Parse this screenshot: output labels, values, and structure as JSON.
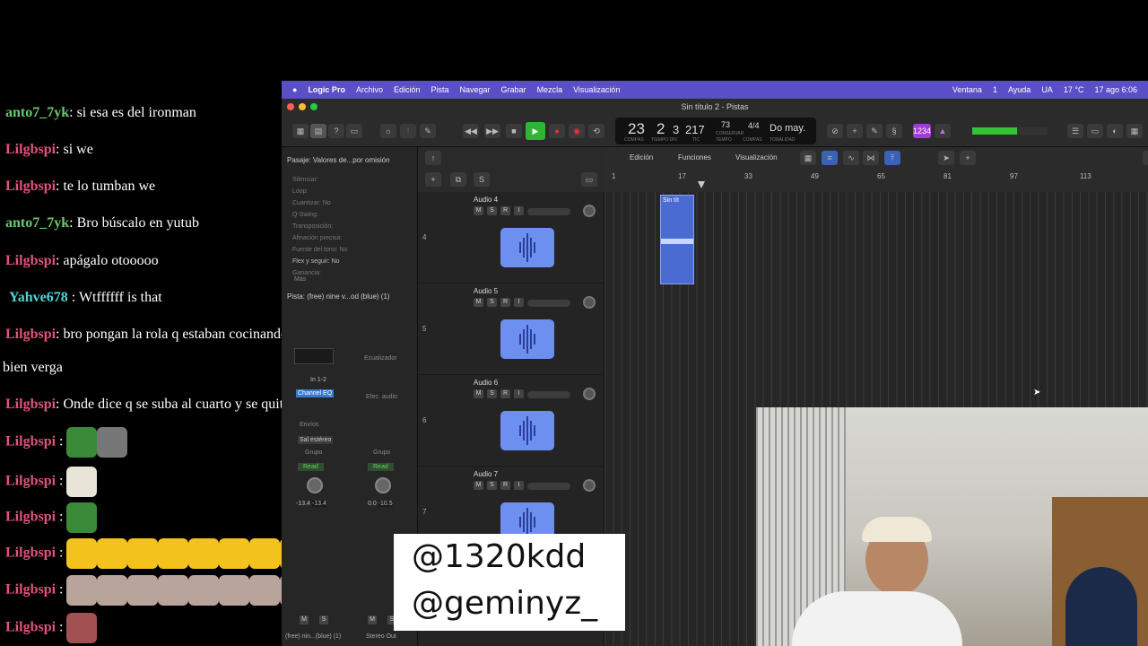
{
  "chat": [
    {
      "user": "anto7_7yk",
      "color": "#6cc86c",
      "text": ": si esa es del ironman"
    },
    {
      "user": "Lilgbspi",
      "color": "#e0547a",
      "text": ": si we"
    },
    {
      "user": "Lilgbspi",
      "color": "#e0547a",
      "text": ": te lo tumban we"
    },
    {
      "user": "anto7_7yk",
      "color": "#6cc86c",
      "text": ": Bro búscalo en yutub"
    },
    {
      "user": "Lilgbspi",
      "color": "#e0547a",
      "text": ": apágalo otooooo"
    },
    {
      "user": "Yahve678",
      "color": "#4fd6d6",
      "text": " : Wtffffff is that"
    },
    {
      "user": "Lilgbspi",
      "color": "#e0547a",
      "text": ": bro pongan la rola q estaban cocinando hace rato está"
    },
    {
      "user": "",
      "color": "#fff",
      "text": "bien verga"
    },
    {
      "user": "Lilgbspi",
      "color": "#e0547a",
      "text": ": Onde dice q se suba al cuarto y se quite los Valentino"
    },
    {
      "user": "Lilgbspi",
      "color": "#e0547a",
      "text": " :"
    },
    {
      "user": "Lilgbspi",
      "color": "#e0547a",
      "text": " :"
    },
    {
      "user": "Lilgbspi",
      "color": "#e0547a",
      "text": " :"
    },
    {
      "user": "Lilgbspi",
      "color": "#e0547a",
      "text": " :"
    },
    {
      "user": "Lilgbspi",
      "color": "#e0547a",
      "text": " :"
    },
    {
      "user": "Lilgbspi",
      "color": "#e0547a",
      "text": " :"
    }
  ],
  "menubar": {
    "app": "Logic Pro",
    "items": [
      "Archivo",
      "Edición",
      "Pista",
      "Navegar",
      "Grabar",
      "Mezcla",
      "Visualización"
    ],
    "right": [
      "Ventana",
      "1",
      "Ayuda",
      "UA",
      "17 °C",
      "17 ago 6:06"
    ]
  },
  "window_title": "Sin título 2 - Pistas",
  "lcd": {
    "bar": "23",
    "beat": "2",
    "div": "3",
    "tick": "217",
    "tempo": "73",
    "sig": "4/4",
    "key": "Do may.",
    "l1": "COMPÁS",
    "l2": "TIEMPO DIV.",
    "l3": "TIC",
    "l4": "TEMPO",
    "l5": "COMPÁS",
    "l6": "TONALIDAD",
    "tempo_mode": "CONSERVAR"
  },
  "toolbar": {
    "count": "1234"
  },
  "inspector": {
    "passage": "Pasaje: Valores de...por omisión",
    "rows": [
      "Silenciar:",
      "Loop:",
      "Cuantizar: No",
      "Q-Swing:",
      "Transposición:",
      "Afinación precisa:",
      "Fuente del tono: No",
      "Flex y seguir: No",
      "Ganancia:"
    ],
    "more": "Más",
    "track": "Pista: (free) nine v...od (blue) (1)",
    "eq": "Ecualizador",
    "input": "In 1-2",
    "channel_eq": "Channel EQ",
    "audio_fx": "Efec. audio",
    "sends": "Envíos",
    "stereo_out": "Sal estéreo",
    "group": "Grupo",
    "read": "Read",
    "vol1": "-13.4",
    "vol2": "-13.4",
    "vol3": "0.0",
    "vol4": "-10.5",
    "m": "M",
    "s": "S",
    "strip1": "(free) nin...(blue) (1)",
    "strip2": "Stereo Out"
  },
  "arrange_bar": {
    "edit": "Edición",
    "functions": "Funciones",
    "view": "Visualización"
  },
  "ruler": [
    "1",
    "17",
    "33",
    "49",
    "65",
    "81",
    "97",
    "113"
  ],
  "tracks": [
    {
      "name": "Audio 4",
      "num": "4"
    },
    {
      "name": "Audio 5",
      "num": "5"
    },
    {
      "name": "Audio 6",
      "num": "6"
    },
    {
      "name": "Audio 7",
      "num": "7"
    }
  ],
  "region_label": "Sin tít",
  "overlay": {
    "line1": "@1320kdd",
    "line2": "@geminyz_"
  }
}
